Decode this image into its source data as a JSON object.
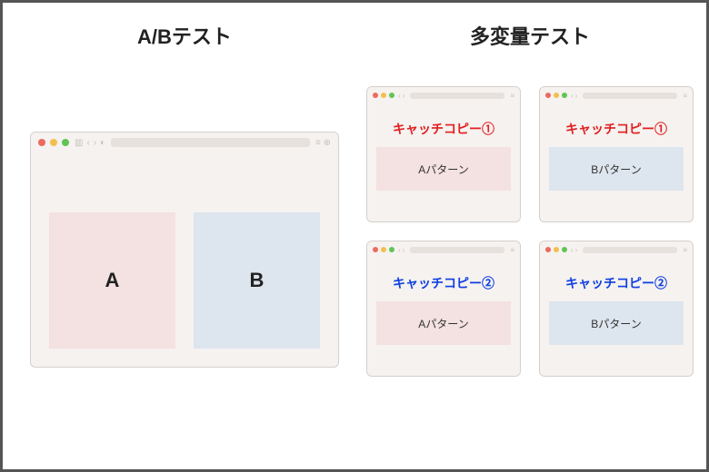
{
  "left": {
    "title": "A/Bテスト",
    "panelA": "A",
    "panelB": "B"
  },
  "right": {
    "title": "多変量テスト",
    "cells": [
      {
        "copy": "キャッチコピー①",
        "copyColor": "red",
        "pattern": "Aパターン",
        "patternColor": "pink"
      },
      {
        "copy": "キャッチコピー①",
        "copyColor": "red",
        "pattern": "Bパターン",
        "patternColor": "blue"
      },
      {
        "copy": "キャッチコピー②",
        "copyColor": "blue",
        "pattern": "Aパターン",
        "patternColor": "pink"
      },
      {
        "copy": "キャッチコピー②",
        "copyColor": "blue",
        "pattern": "Bパターン",
        "patternColor": "blue"
      }
    ]
  }
}
